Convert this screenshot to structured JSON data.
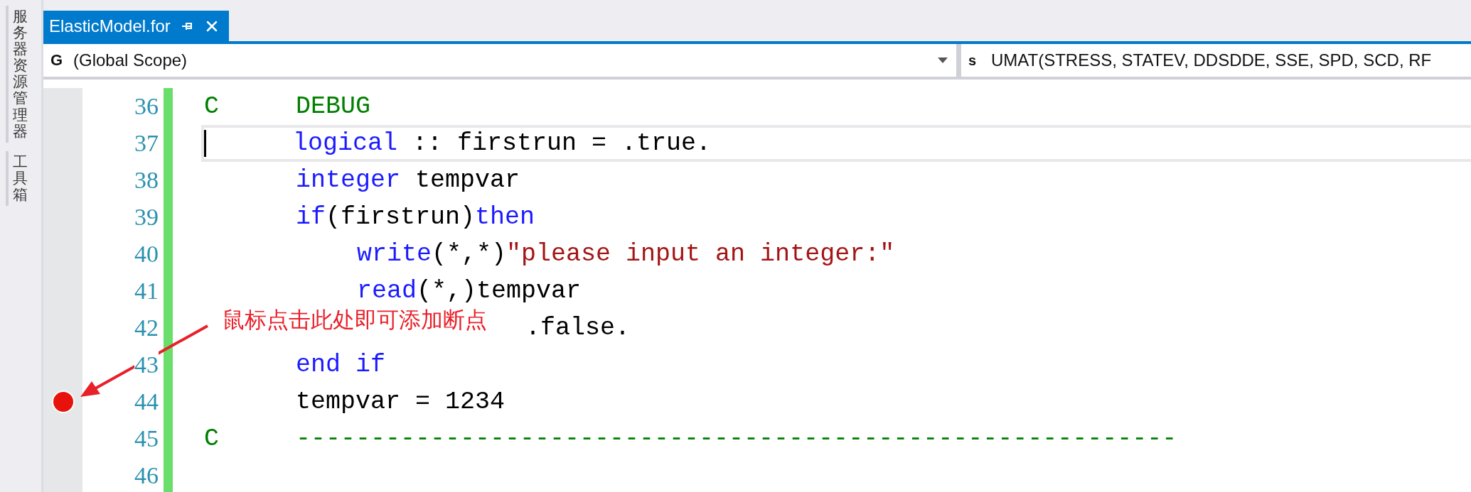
{
  "side_panel": {
    "tabs": [
      {
        "label": "服务器资源管理器"
      },
      {
        "label": "工具箱"
      }
    ]
  },
  "tabs": [
    {
      "label": "ElasticModel.for",
      "selected": true
    }
  ],
  "nav_bar": {
    "scope": {
      "glyph": "G",
      "label": "(Global Scope)"
    },
    "member": {
      "glyph": "s",
      "label": "UMAT(STRESS, STATEV, DDSDDE, SSE, SPD, SCD, RF"
    }
  },
  "code_lines": [
    {
      "number": "36",
      "kind": "comment",
      "marker": "C",
      "current": false,
      "breakpoint": false,
      "tokens": [
        {
          "kind": "comment",
          "text": "DEBUG"
        }
      ]
    },
    {
      "number": "37",
      "kind": "statement",
      "current": true,
      "breakpoint": false,
      "tokens": [
        {
          "kind": "keyword",
          "text": "logical"
        },
        {
          "kind": "plain",
          "text": " :: firstrun = .true."
        }
      ]
    },
    {
      "number": "38",
      "kind": "statement",
      "current": false,
      "breakpoint": false,
      "tokens": [
        {
          "kind": "keyword",
          "text": "integer"
        },
        {
          "kind": "plain",
          "text": " tempvar"
        }
      ]
    },
    {
      "number": "39",
      "kind": "statement",
      "current": false,
      "breakpoint": false,
      "tokens": [
        {
          "kind": "keyword",
          "text": "if"
        },
        {
          "kind": "plain",
          "text": "(firstrun)"
        },
        {
          "kind": "keyword",
          "text": "then"
        }
      ]
    },
    {
      "number": "40",
      "kind": "nested",
      "current": false,
      "breakpoint": false,
      "tokens": [
        {
          "kind": "keyword",
          "text": "write"
        },
        {
          "kind": "plain",
          "text": "(*,*)"
        },
        {
          "kind": "string",
          "text": "\"please input an integer:\""
        }
      ]
    },
    {
      "number": "41",
      "kind": "nested",
      "current": false,
      "breakpoint": false,
      "tokens": [
        {
          "kind": "keyword",
          "text": "read"
        },
        {
          "kind": "plain",
          "text": "(*,)tempvar"
        }
      ]
    },
    {
      "number": "42",
      "kind": "covered",
      "current": false,
      "breakpoint": false,
      "tokens": [
        {
          "kind": "plain",
          "text": ".false."
        }
      ]
    },
    {
      "number": "43",
      "kind": "statement",
      "current": false,
      "breakpoint": false,
      "tokens": [
        {
          "kind": "keyword",
          "text": "end if"
        }
      ]
    },
    {
      "number": "44",
      "kind": "statement",
      "current": false,
      "breakpoint": true,
      "tokens": [
        {
          "kind": "plain",
          "text": "tempvar = 1234"
        }
      ]
    },
    {
      "number": "45",
      "kind": "comment",
      "marker": "C",
      "current": false,
      "breakpoint": false,
      "tokens": [
        {
          "kind": "comment",
          "text": "-----------------------------------------------------------"
        }
      ]
    },
    {
      "number": "46",
      "kind": "statement",
      "current": false,
      "breakpoint": false
    }
  ],
  "annotation": {
    "text": "鼠标点击此处即可添加断点"
  }
}
